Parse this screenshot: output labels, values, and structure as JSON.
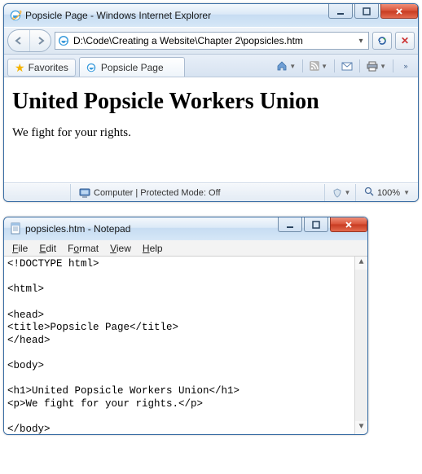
{
  "ie": {
    "window_title": "Popsicle Page - Windows Internet Explorer",
    "address": "D:\\Code\\Creating a Website\\Chapter 2\\popsicles.htm",
    "favorites_label": "Favorites",
    "tab_label": "Popsicle Page",
    "page": {
      "heading": "United Popsicle Workers Union",
      "paragraph": "We fight for your rights."
    },
    "status": {
      "zone_text": "Computer | Protected Mode: Off",
      "zoom": "100%"
    }
  },
  "notepad": {
    "window_title": "popsicles.htm - Notepad",
    "menu": {
      "file": "File",
      "edit": "Edit",
      "format": "Format",
      "view": "View",
      "help": "Help"
    },
    "content": "<!DOCTYPE html>\n\n<html>\n\n<head>\n<title>Popsicle Page</title>\n</head>\n\n<body>\n\n<h1>United Popsicle Workers Union</h1>\n<p>We fight for your rights.</p>\n\n</body>\n\n</html>"
  }
}
